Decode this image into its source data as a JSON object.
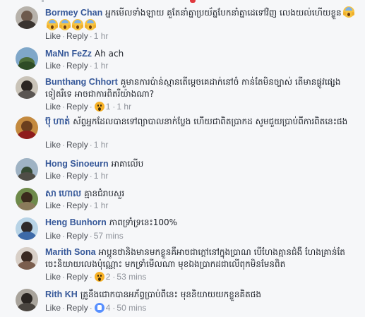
{
  "actions": {
    "like_label": "Like",
    "reply_label": "Reply",
    "separator": "·"
  },
  "comments": [
    {
      "author": "Bormey Chan",
      "text": "អ្នកមើលទាំងឡាយ គួតែនាំគ្នាប្រយ័ត្នបែកនាំគ្នាដេទៅវិញ លេងយល់ហើយខ្លួន",
      "emoji_count": 5,
      "emoji_name": "face-screaming-in-fear",
      "time": "1 hr"
    },
    {
      "author": "MaNn FeZz",
      "text": "Ah ach",
      "time": "1 hr"
    },
    {
      "author": "Bunthang Chhort",
      "text": "គួមានការប៉ាន់ស្មានតើម្ដេចគេដាក់នៅចំ កាន់តែមិនច្បាស់ តើមានផ្លូវផ្សេងទៀតរឺទេ អាចជាការពិតរឺយ៉ាងណា?",
      "reaction": "wow",
      "reaction_count": "1",
      "time": "1 hr"
    },
    {
      "author": "ប៊ុ ហាត់",
      "text": "ស័ព្ទអ្នកដែលបានទៅព្យាបាលនាក់ប្លែង ហើយជាពិតប្រាកដ សូមជួយប្រាប់ពីការពិតនេះផង",
      "time": "1 hr"
    },
    {
      "author": "Hong Sinoeurn",
      "text": "អាគាលើប",
      "time": "1 hr"
    },
    {
      "author": "សា ហោល",
      "text": "គ្មានជំរាបសួរ",
      "time": "1 hr"
    },
    {
      "author": "Heng Bunhorn",
      "text": "ភាពទ្រាំទ្រនេះ100%",
      "time": "57 mins"
    },
    {
      "author": "Marith Sona",
      "text": "អាប្អូនថានិងមានមកខ្លួនគឺអាចជាក្ដៅនៅក្នុងប្រាណ បើហែងគ្មានជំងឺ ហែងគ្រាន់តែចេះនិយាយលេងប៉ុណ្ណោះ មកទ្រាំមើលណា មុខឯងប្រាកដជាលើពុកមិនមែនពិត",
      "reaction": "wow",
      "reaction_count": "2",
      "time": "53 mins"
    },
    {
      "author": "Rith KH",
      "text": "គ្រូនឹងជោកបានអភ័ព្វប្រាប់ពីនេះ មុននិយាយយកខ្លួនគិតផង",
      "reaction": "like",
      "reaction_count": "4",
      "time": "50 mins"
    }
  ]
}
